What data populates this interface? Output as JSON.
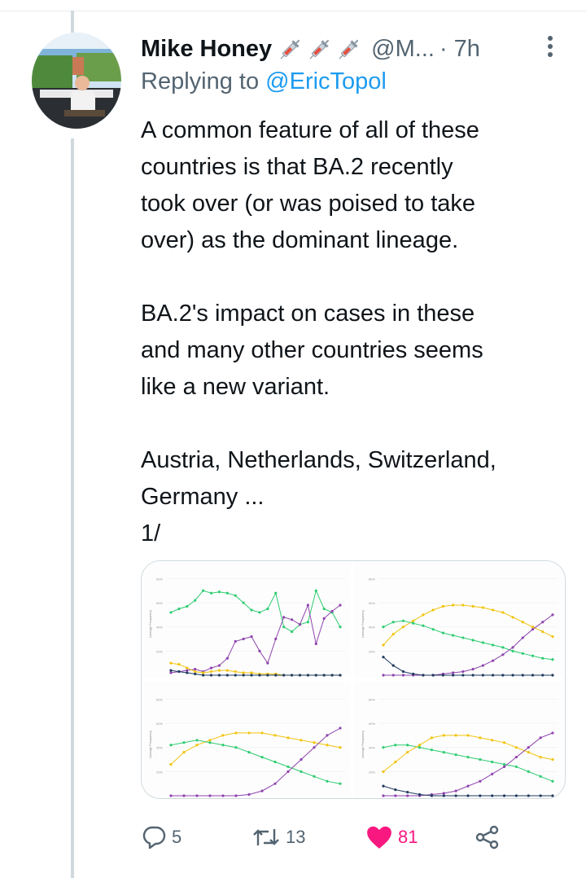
{
  "tweet": {
    "author_name": "Mike Honey",
    "author_emojis": [
      "syringe-icon",
      "syringe-icon",
      "syringe-icon"
    ],
    "handle": "@M...",
    "time": "· 7h",
    "reply_prefix": "Replying to ",
    "reply_to": "@EricTopol",
    "paragraphs": [
      "A common feature of all of these\ncountries is that BA.2 recently\ntook over (or was poised to take\nover) as the dominant lineage.",
      "BA.2's impact on cases in these\nand many other countries seems\nlike a new variant.",
      "Austria, Netherlands, Switzerland,\nGermany ...\n1/"
    ]
  },
  "actions": {
    "replies": "5",
    "retweets": "13",
    "likes": "81"
  },
  "colors": {
    "text": "#0f1419",
    "secondary": "#536471",
    "link": "#1d9bf0",
    "like": "#f91880",
    "series_green": "#2ecc71",
    "series_purple": "#8e44ad",
    "series_yellow": "#f1c40f",
    "series_navy": "#1f3a5f"
  },
  "chart_data": [
    {
      "type": "line",
      "ylabel": "Lineage Frequency",
      "yticks": [
        "80%",
        "60%",
        "40%",
        "20%"
      ],
      "ylim": [
        0,
        85
      ],
      "grid": true,
      "series": [
        {
          "color": "#2ecc71",
          "values": [
            52,
            55,
            57,
            62,
            70,
            68,
            69,
            68,
            66,
            60,
            54,
            52,
            55,
            68,
            40,
            36,
            42,
            44,
            70,
            55,
            52,
            40
          ]
        },
        {
          "color": "#8e44ad",
          "values": [
            2,
            3,
            4,
            5,
            3,
            6,
            8,
            14,
            28,
            30,
            32,
            20,
            10,
            30,
            48,
            46,
            42,
            58,
            26,
            47,
            53,
            58
          ]
        },
        {
          "color": "#f1c40f",
          "values": [
            10,
            9,
            6,
            3,
            2,
            3,
            4,
            4,
            3,
            2,
            2,
            1,
            1,
            1,
            0,
            0,
            0,
            0,
            0,
            0,
            0,
            0
          ]
        },
        {
          "color": "#1f3a5f",
          "values": [
            4,
            3,
            2,
            1,
            0,
            0,
            0,
            0,
            0,
            0,
            0,
            0,
            0,
            0,
            0,
            0,
            0,
            0,
            0,
            0,
            0,
            0
          ]
        }
      ]
    },
    {
      "type": "line",
      "ylabel": "Lineage Frequency",
      "yticks": [
        "80%",
        "60%",
        "40%",
        "20%"
      ],
      "ylim": [
        0,
        85
      ],
      "grid": true,
      "series": [
        {
          "color": "#f1c40f",
          "values": [
            25,
            34,
            40,
            45,
            50,
            54,
            57,
            58,
            58,
            57,
            56,
            54,
            52,
            48,
            44,
            40,
            36,
            32
          ]
        },
        {
          "color": "#2ecc71",
          "values": [
            40,
            44,
            45,
            43,
            41,
            38,
            35,
            33,
            31,
            29,
            27,
            25,
            23,
            20,
            18,
            16,
            14,
            13
          ]
        },
        {
          "color": "#8e44ad",
          "values": [
            0,
            0,
            0,
            0,
            0,
            0,
            1,
            2,
            3,
            5,
            8,
            12,
            17,
            23,
            31,
            38,
            44,
            50
          ]
        },
        {
          "color": "#1f3a5f",
          "values": [
            15,
            8,
            3,
            1,
            0,
            0,
            0,
            0,
            0,
            0,
            0,
            0,
            0,
            0,
            0,
            0,
            0,
            0
          ]
        }
      ]
    },
    {
      "type": "line",
      "ylabel": "Lineage Frequency",
      "yticks": [
        "80%",
        "60%",
        "40%",
        "20%"
      ],
      "ylim": [
        0,
        85
      ],
      "grid": true,
      "series": [
        {
          "color": "#f1c40f",
          "values": [
            26,
            36,
            42,
            46,
            50,
            52,
            52,
            52,
            50,
            48,
            46,
            44,
            42,
            40
          ]
        },
        {
          "color": "#2ecc71",
          "values": [
            42,
            44,
            46,
            44,
            42,
            40,
            36,
            32,
            28,
            24,
            20,
            16,
            12,
            10
          ]
        },
        {
          "color": "#8e44ad",
          "values": [
            0,
            0,
            0,
            0,
            0,
            0,
            1,
            4,
            10,
            20,
            30,
            40,
            50,
            56
          ]
        }
      ]
    },
    {
      "type": "line",
      "ylabel": "Lineage Frequency",
      "yticks": [
        "80%",
        "60%",
        "40%",
        "20%"
      ],
      "ylim": [
        0,
        85
      ],
      "grid": true,
      "series": [
        {
          "color": "#2ecc71",
          "values": [
            40,
            42,
            42,
            40,
            38,
            36,
            34,
            32,
            30,
            28,
            26,
            24,
            20,
            16,
            12
          ]
        },
        {
          "color": "#f1c40f",
          "values": [
            20,
            28,
            36,
            42,
            48,
            50,
            50,
            50,
            48,
            46,
            44,
            40,
            36,
            32,
            30
          ]
        },
        {
          "color": "#8e44ad",
          "values": [
            0,
            0,
            0,
            0,
            1,
            2,
            4,
            8,
            12,
            18,
            24,
            32,
            40,
            48,
            52
          ]
        },
        {
          "color": "#1f3a5f",
          "values": [
            8,
            5,
            3,
            1,
            0,
            0,
            0,
            0,
            0,
            0,
            0,
            0,
            0,
            0,
            0
          ]
        }
      ]
    }
  ]
}
